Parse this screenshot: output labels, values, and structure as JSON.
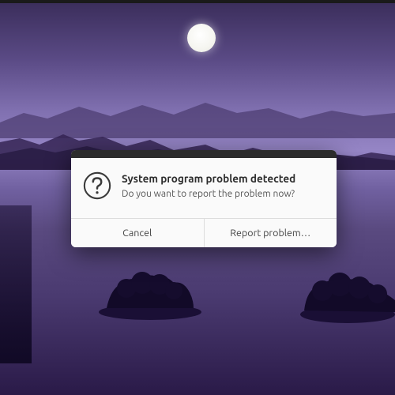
{
  "dialog": {
    "title": "System program problem detected",
    "subtitle": "Do you want to report the problem now?",
    "cancel_label": "Cancel",
    "report_label": "Report problem…"
  }
}
